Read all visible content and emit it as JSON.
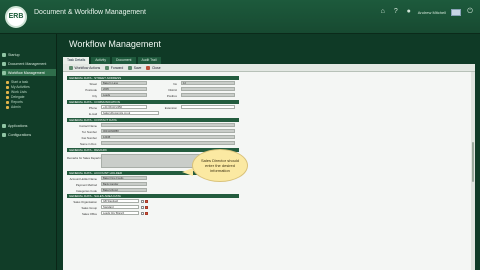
{
  "header": {
    "logo_text": "ERB",
    "app_title": "Document & Workflow Management",
    "user_name": "Andrew Mitchell"
  },
  "sidebar": {
    "items": [
      {
        "label": "Startup",
        "active": false
      },
      {
        "label": "Document Management",
        "active": false
      },
      {
        "label": "Workflow Management",
        "active": true
      }
    ],
    "subitems": [
      "Start a task",
      "My Activities",
      "Work Lists",
      "Delegate",
      "Reports",
      "Admin"
    ],
    "footer_items": [
      "Applications",
      "Configurations"
    ]
  },
  "main": {
    "title": "Workflow Management",
    "tabs": [
      {
        "label": "Task Details",
        "active": true
      },
      {
        "label": "Activity",
        "active": false
      },
      {
        "label": "Document",
        "active": false
      },
      {
        "label": "Audit Trail",
        "active": false
      }
    ],
    "toolbar": [
      "Workflow Actions",
      "Forward",
      "Save",
      "Close"
    ]
  },
  "sections": [
    "GENERAL DATA - STREET ADDRESS",
    "GENERAL DATA - COMMUNICATION",
    "GENERAL DATA - CONTACT DATA",
    "GENERAL DATA - REMARK",
    "GENERAL DATA - ACCOUNT HOLDER",
    "GENERAL DATA - SALES AREA DATA"
  ],
  "address": {
    "street_label": "Street",
    "street_value": "Baker's Lane",
    "no_label": "No",
    "no_value": "12",
    "postcode_label": "Postcode",
    "postcode_value": "2005",
    "district_label": "District",
    "district_value": "",
    "city_label": "City",
    "city_value": "Leeds",
    "postbox_label": "Postbox",
    "postbox_value": ""
  },
  "communication": {
    "phone_label": "Phone",
    "phone_value": "+44 (0)113 2456",
    "extension_label": "Extension",
    "extension_value": "",
    "email_label": "E-mail",
    "email_value": "bakers@example.co.uk"
  },
  "contact": {
    "first_label": "Contact Name",
    "first_value": "",
    "second_label": "Tel. Number",
    "second_value": "00311090888",
    "third_label": "Fax Number",
    "third_value": "12345",
    "fourth_label": "Name in Doc.",
    "fourth_value": ""
  },
  "remark": {
    "label": "Remarks for Sales Department",
    "value": ""
  },
  "account": {
    "field1_label": "Account Holder Name",
    "field1_value": "Baker Fine Foods",
    "field2_label": "Payment Method",
    "field2_value": "Bank transfer",
    "field3_label": "Categories Code",
    "field3_value": "Bakery/Food"
  },
  "sales": {
    "field1_label": "Sales Organisation",
    "field1_value": "GB Standard",
    "field2_label": "Sales Group",
    "field2_value": "Standard",
    "field3_label": "Sales Office",
    "field3_value": "Leeds City Branch"
  },
  "callout": {
    "text": "Sales Director should enter the desired information"
  }
}
